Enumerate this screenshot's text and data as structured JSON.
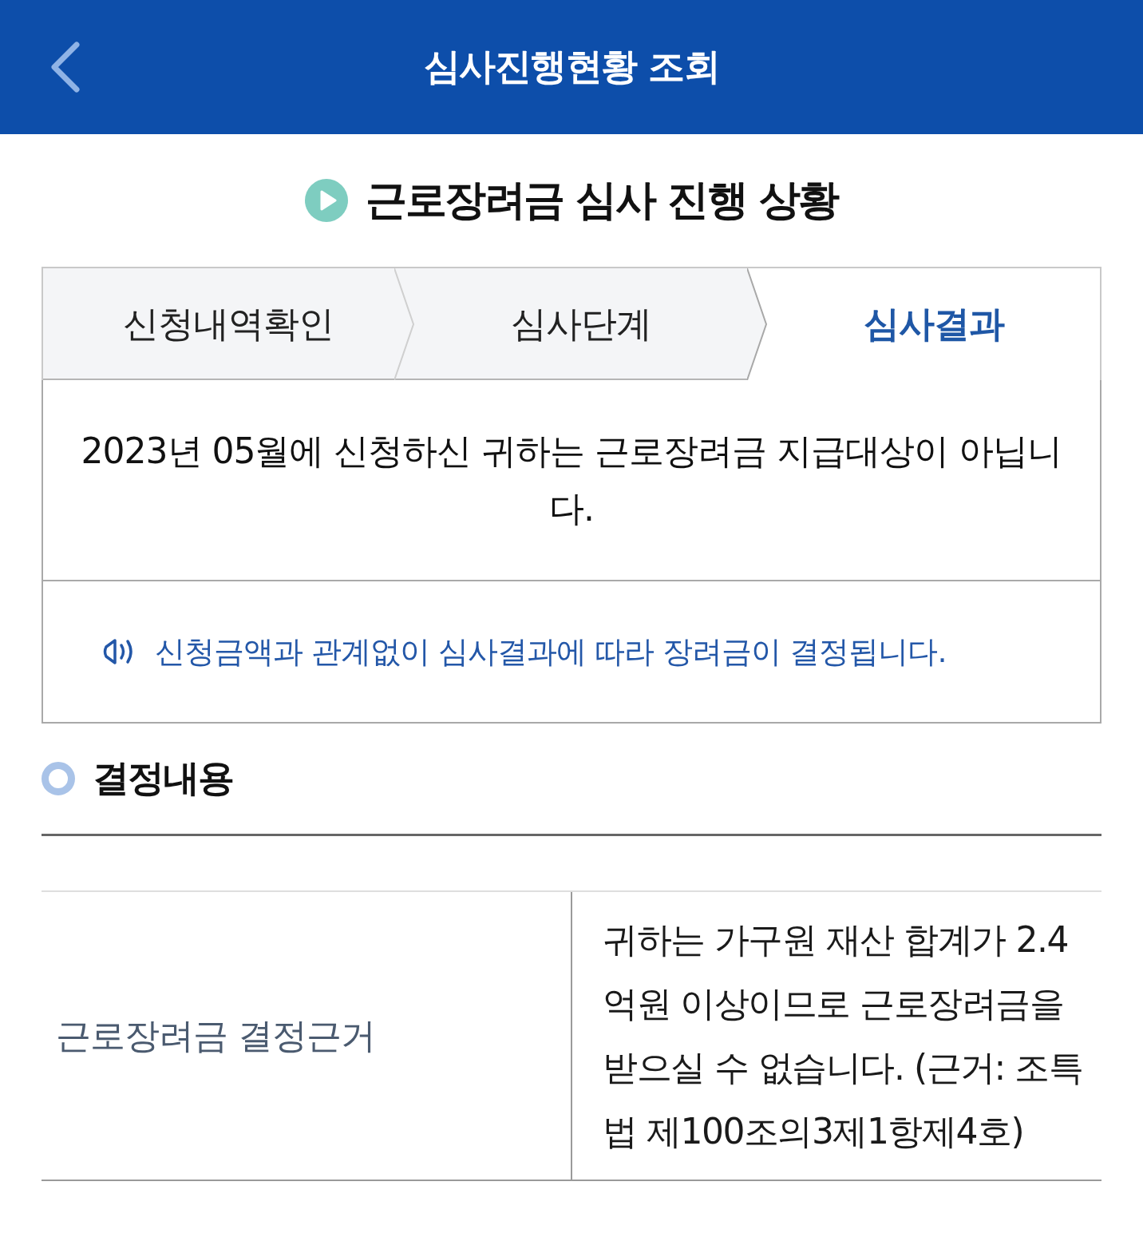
{
  "header": {
    "title": "심사진행현황 조회"
  },
  "page_title": "근로장려금 심사 진행 상황",
  "steps": [
    {
      "label": "신청내역확인",
      "selected": false
    },
    {
      "label": "심사단계",
      "selected": false
    },
    {
      "label": "심사결과",
      "selected": true
    }
  ],
  "result_message": "2023년 05월에 신청하신 귀하는 근로장려금 지급대상이 아닙니다.",
  "notice": "신청금액과 관계없이 심사결과에 따라 장려금이 결정됩니다.",
  "decision_section": {
    "heading": "결정내용",
    "rows": [
      {
        "label": "근로장려금 결정근거",
        "value": "귀하는 가구원 재산 합계가 2.4억원 이상이므로 근로장려금을 받으실 수 없습니다. (근거: 조특법 제100조의3제1항제4호)"
      }
    ]
  }
}
